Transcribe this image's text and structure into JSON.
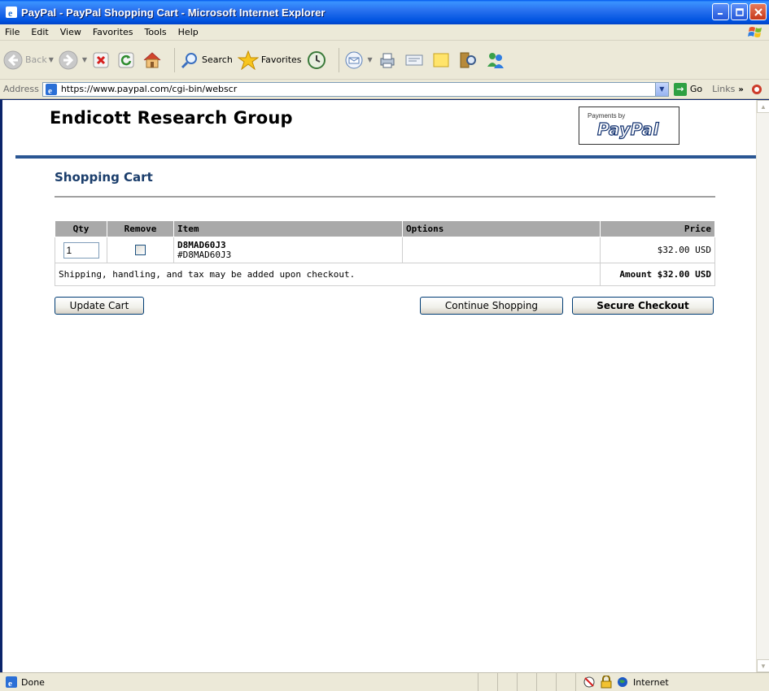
{
  "window": {
    "title": "PayPal - PayPal Shopping Cart - Microsoft Internet Explorer"
  },
  "menu": {
    "items": [
      "File",
      "Edit",
      "View",
      "Favorites",
      "Tools",
      "Help"
    ]
  },
  "toolbar": {
    "back_label": "Back",
    "search_label": "Search",
    "favorites_label": "Favorites"
  },
  "address": {
    "label": "Address",
    "url": "https://www.paypal.com/cgi-bin/webscr",
    "go_label": "Go",
    "links_label": "Links",
    "links_chevron": "»"
  },
  "page": {
    "merchant_name": "Endicott Research Group",
    "paypal_logo": {
      "payments_by": "Payments by",
      "brand": "PayPal"
    },
    "section_title": "Shopping Cart",
    "colors": {
      "rule_blue": "#2a5693",
      "title_blue": "#1a3d6b",
      "header_gray": "#a9a9a9"
    }
  },
  "cart": {
    "headers": {
      "qty": "Qty",
      "remove": "Remove",
      "item": "Item",
      "options": "Options",
      "price": "Price"
    },
    "items": [
      {
        "qty": "1",
        "remove_checked": false,
        "item_name": "D8MAD60J3",
        "item_number": "#D8MAD60J3",
        "options": "",
        "price": "$32.00 USD"
      }
    ],
    "shipping_note": "Shipping, handling, and tax may be added upon checkout.",
    "amount": "Amount $32.00 USD"
  },
  "buttons": {
    "update": "Update Cart",
    "continue": "Continue Shopping",
    "checkout": "Secure Checkout"
  },
  "status": {
    "text": "Done",
    "zone": "Internet"
  }
}
